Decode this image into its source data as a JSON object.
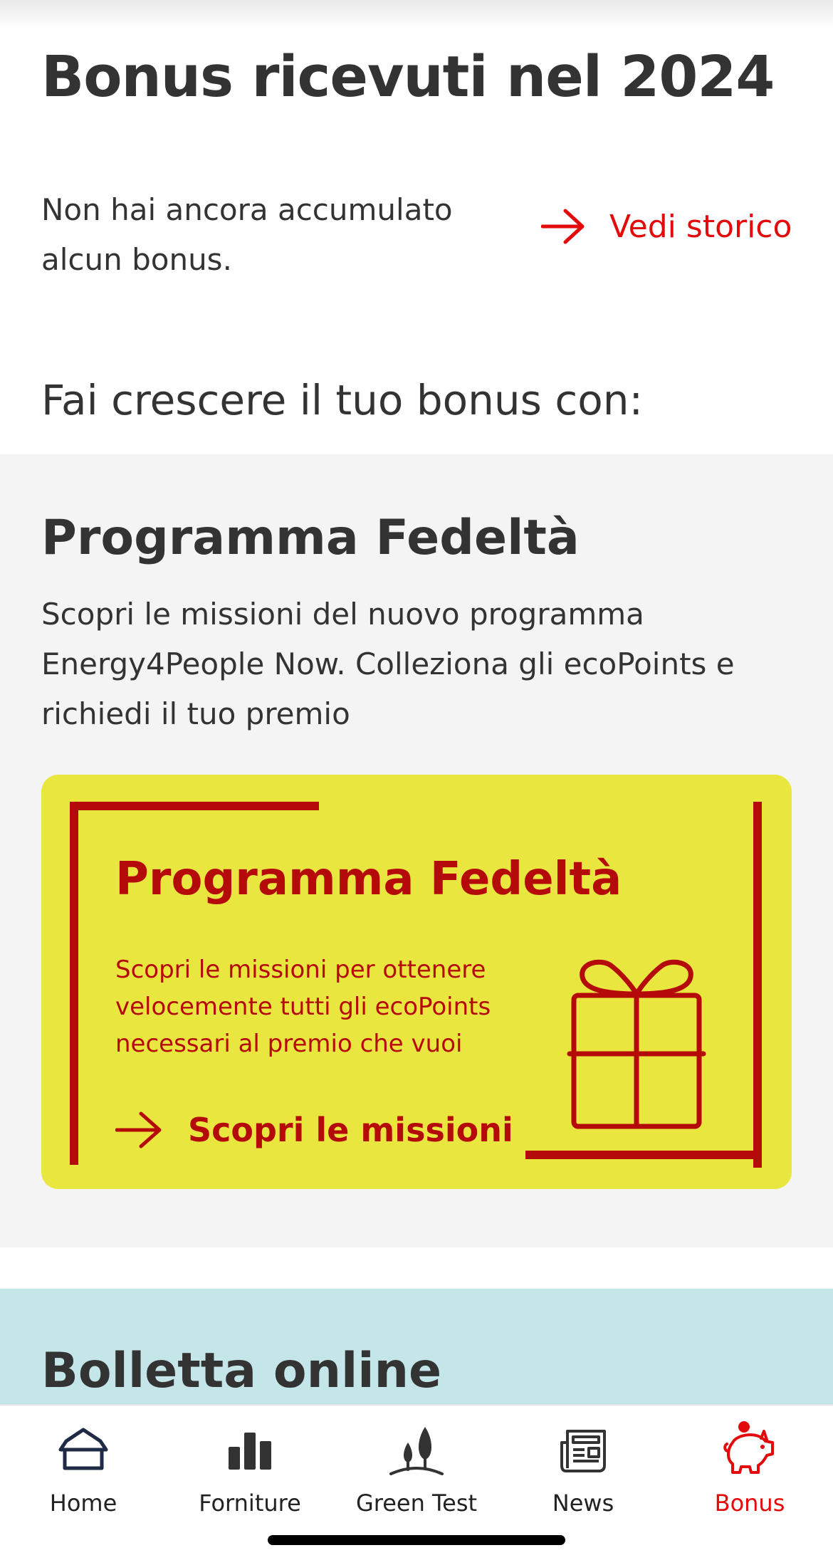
{
  "header": {
    "title": "Bonus ricevuti nel 2024",
    "empty_message": "Non hai ancora accumulato alcun bonus.",
    "history_link": "Vedi storico"
  },
  "grow_section": {
    "title": "Fai crescere il tuo bonus con:"
  },
  "loyalty": {
    "title": "Programma Fedeltà",
    "description": "Scopri le missioni del nuovo programma Energy4People Now. Colleziona gli ecoPoints e richiedi il tuo premio",
    "card": {
      "title": "Programma Fedeltà",
      "description": "Scopri le missioni per ottenere velocemente tutti gli ecoPoints necessari al premio che vuoi",
      "cta": "Scopri le missioni",
      "icon": "gift-icon",
      "background_color": "#e9e63f",
      "accent_color": "#b50a0a"
    }
  },
  "bill_section": {
    "title": "Bolletta online",
    "background_color": "#c5e6e8"
  },
  "tabbar": {
    "active_tab": "Bonus",
    "active_color": "#e20a0a",
    "items": [
      {
        "label": "Home",
        "icon": "home-icon"
      },
      {
        "label": "Forniture",
        "icon": "bar-chart-icon"
      },
      {
        "label": "Green Test",
        "icon": "trees-icon"
      },
      {
        "label": "News",
        "icon": "newspaper-icon"
      },
      {
        "label": "Bonus",
        "icon": "piggy-bank-icon"
      }
    ]
  },
  "colors": {
    "brand_red": "#e20a0a",
    "text": "#333333",
    "section_gray": "#f4f4f4"
  }
}
